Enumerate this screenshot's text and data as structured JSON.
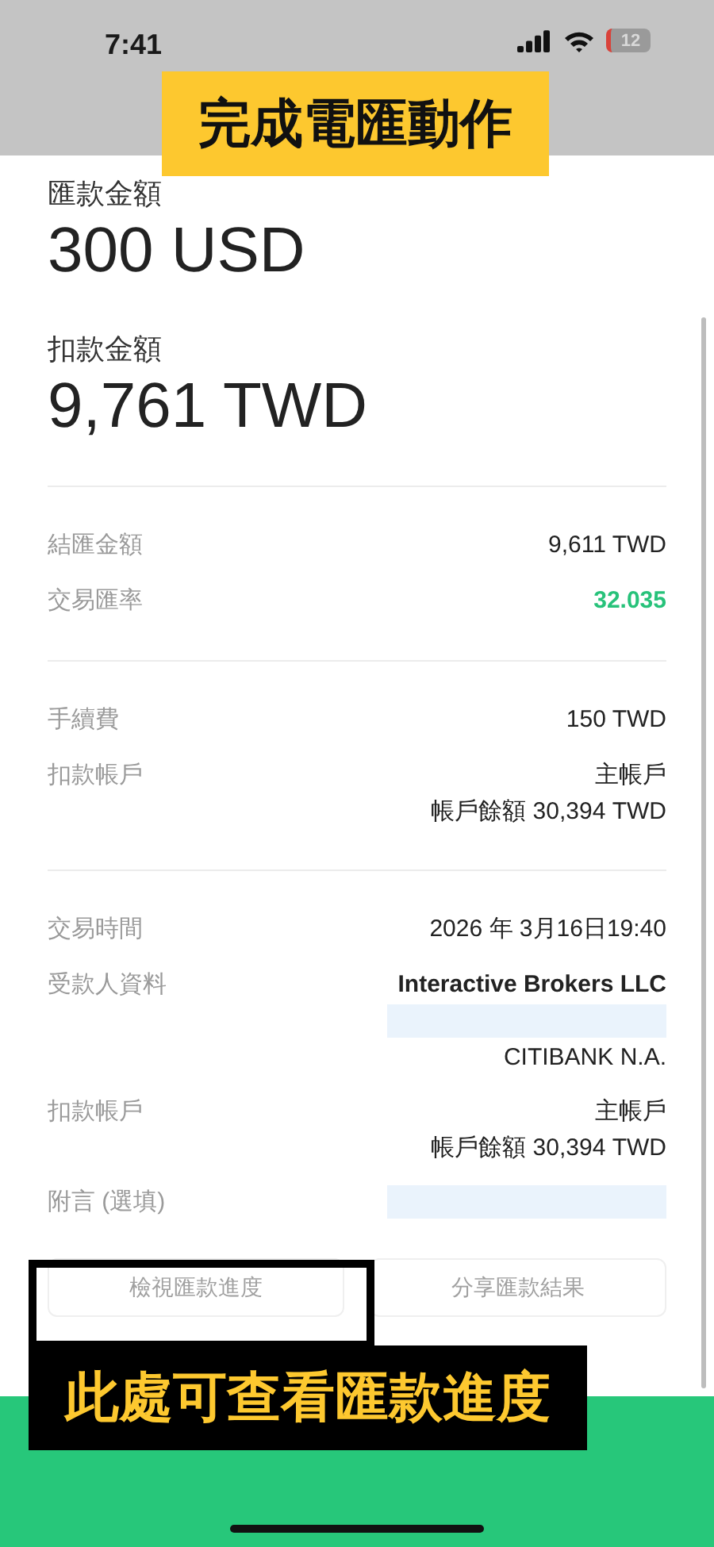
{
  "status_bar": {
    "time": "7:41",
    "battery": "12"
  },
  "summary": [
    {
      "label": "匯款金額",
      "amount": "300 USD"
    },
    {
      "label": "扣款金額",
      "amount": "9,761 TWD"
    }
  ],
  "sections": [
    {
      "rows": [
        {
          "label": "結匯金額",
          "values": [
            {
              "kind": "plain",
              "text": "9,611 TWD"
            }
          ]
        },
        {
          "label": "交易匯率",
          "values": [
            {
              "kind": "accent",
              "text": "32.035"
            }
          ]
        }
      ]
    },
    {
      "rows": [
        {
          "label": "手續費",
          "values": [
            {
              "kind": "plain",
              "text": "150 TWD"
            }
          ]
        },
        {
          "label": "扣款帳戶",
          "values": [
            {
              "kind": "plain",
              "text": "主帳戶"
            },
            {
              "kind": "plain",
              "text": "帳戶餘額 30,394 TWD"
            }
          ]
        }
      ]
    },
    {
      "rows": [
        {
          "label": "交易時間",
          "values": [
            {
              "kind": "plain",
              "text": "2026 年 3月16日19:40"
            }
          ]
        },
        {
          "label": "受款人資料",
          "values": [
            {
              "kind": "bold",
              "text": "Interactive Brokers LLC"
            },
            {
              "kind": "redacted"
            },
            {
              "kind": "plain",
              "text": "CITIBANK N.A."
            }
          ]
        },
        {
          "label": "扣款帳戶",
          "values": [
            {
              "kind": "plain",
              "text": "主帳戶"
            },
            {
              "kind": "plain",
              "text": "帳戶餘額 30,394 TWD"
            }
          ]
        },
        {
          "label": "附言 (選填)",
          "values": [
            {
              "kind": "redacted"
            }
          ]
        }
      ]
    }
  ],
  "actions": [
    "檢視匯款進度",
    "分享匯款結果"
  ],
  "annotations": [
    {
      "kind": "banner",
      "text": "完成電匯動作"
    },
    {
      "kind": "callout",
      "text": "此處可查看匯款進度"
    }
  ]
}
